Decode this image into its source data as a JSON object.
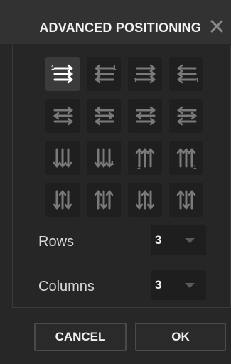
{
  "dialog": {
    "title": "ADVANCED POSITIONING",
    "close_icon": "close-icon"
  },
  "layout_options": [
    {
      "icon": "rows-lr-start-top-left-icon",
      "selected": true
    },
    {
      "icon": "rows-rl-start-top-right-icon",
      "selected": false
    },
    {
      "icon": "rows-lr-start-bottom-left-icon",
      "selected": false
    },
    {
      "icon": "rows-rl-start-bottom-right-icon",
      "selected": false
    },
    {
      "icon": "rows-alternating-lr-icon",
      "selected": false
    },
    {
      "icon": "rows-alternating-rl-icon",
      "selected": false
    },
    {
      "icon": "rows-alternating-lr-bottom-icon",
      "selected": false
    },
    {
      "icon": "rows-alternating-rl-bottom-icon",
      "selected": false
    },
    {
      "icon": "columns-down-start-left-icon",
      "selected": false
    },
    {
      "icon": "columns-down-start-right-icon",
      "selected": false
    },
    {
      "icon": "columns-up-start-left-icon",
      "selected": false
    },
    {
      "icon": "columns-up-start-right-icon",
      "selected": false
    },
    {
      "icon": "columns-alternating-down-left-icon",
      "selected": false
    },
    {
      "icon": "columns-alternating-down-right-icon",
      "selected": false
    },
    {
      "icon": "columns-alternating-up-left-icon",
      "selected": false
    },
    {
      "icon": "columns-alternating-up-right-icon",
      "selected": false
    }
  ],
  "rows": {
    "label": "Rows",
    "value": "3"
  },
  "columns": {
    "label": "Columns",
    "value": "3"
  },
  "buttons": {
    "cancel": "CANCEL",
    "ok": "OK"
  },
  "colors": {
    "selected_bg": "#3b3b3b",
    "icon": "#7a7a7a",
    "icon_selected": "#ffffff"
  }
}
